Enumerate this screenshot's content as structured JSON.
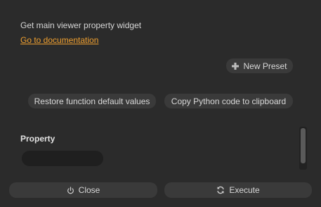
{
  "widget": {
    "description": "Get main viewer property widget",
    "doc_link": "Go to documentation"
  },
  "presets": {
    "new_preset_label": "New Preset",
    "new_preset_icon": "plus-icon"
  },
  "actions": {
    "restore_label": "Restore function default values",
    "copy_label": "Copy Python code to clipboard"
  },
  "property": {
    "label": "Property",
    "value": ""
  },
  "footer": {
    "close_label": "Close",
    "close_icon": "power-icon",
    "execute_label": "Execute",
    "execute_icon": "refresh-icon"
  },
  "colors": {
    "background": "#2b2b2b",
    "button": "#3a3a3a",
    "link": "#f0a030",
    "field": "#1f1f1f"
  }
}
